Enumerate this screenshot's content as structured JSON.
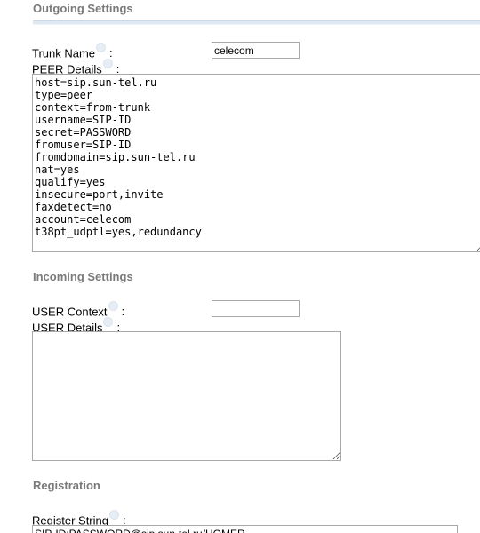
{
  "outgoing": {
    "title": "Outgoing Settings",
    "trunk_name_label": "Trunk Name",
    "trunk_name_value": "celecom",
    "peer_details_label": "PEER Details",
    "peer_details_value": "host=sip.sun-tel.ru\ntype=peer\ncontext=from-trunk\nusername=SIP-ID\nsecret=PASSWORD\nfromuser=SIP-ID\nfromdomain=sip.sun-tel.ru\nnat=yes\nqualify=yes\ninsecure=port,invite\nfaxdetect=no\naccount=celecom\nt38pt_udptl=yes,redundancy"
  },
  "incoming": {
    "title": "Incoming Settings",
    "user_context_label": "USER Context",
    "user_context_value": "",
    "user_details_label": "USER Details",
    "user_details_value": ""
  },
  "registration": {
    "title": "Registration",
    "register_string_label": "Register String",
    "register_string_value": "SIP-ID:PASSWORD@sip.sun-tel.ru/HOMER"
  },
  "colors": {
    "section_title": "#7a7a7a",
    "divider": "#dfe9f3",
    "help_icon": "#e6edf5",
    "input_border": "#a8a8a8"
  },
  "icons": [
    "help-icon"
  ]
}
